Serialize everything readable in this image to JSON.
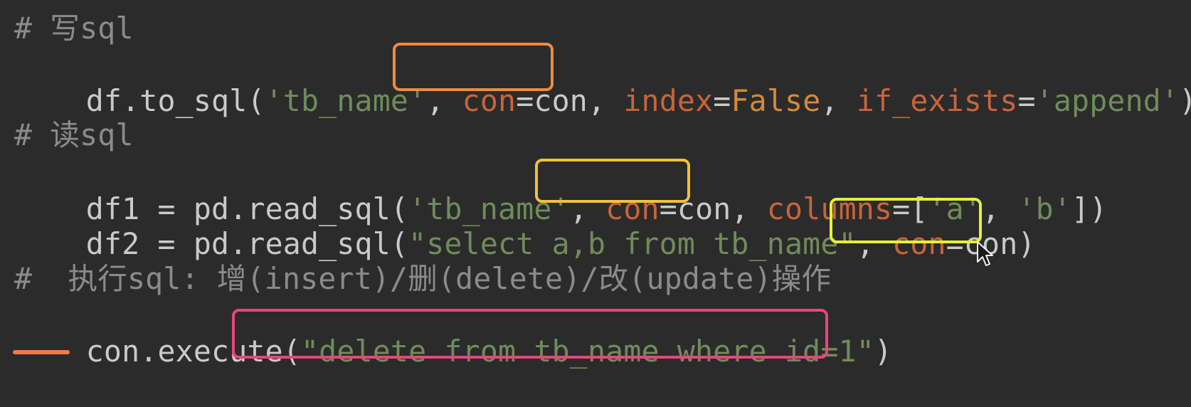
{
  "code": {
    "l1": {
      "comment": "# 写sql"
    },
    "l2": {
      "p1": "df.to_sql(",
      "s1": "'tb_name'",
      "p2": ", ",
      "k1": "con",
      "p3": "=con, ",
      "k2": "index",
      "p4": "=",
      "b1": "False",
      "p5": ", ",
      "k3": "if_exists",
      "p6": "=",
      "s2": "'append'",
      "p7": ")"
    },
    "l4": {
      "comment": "# 读sql"
    },
    "l5": {
      "p1": "df1 = pd.read_sql(",
      "s1": "'tb_name'",
      "p2": ", ",
      "k1": "con",
      "p3": "=con, ",
      "k2": "columns",
      "p4": "=[",
      "s2": "'a'",
      "p5": ", ",
      "s3": "'b'",
      "p6": "])"
    },
    "l6": {
      "p1": "df2 = pd.read_sql(",
      "s1": "\"select a,b from tb_name\"",
      "p2": ", ",
      "k1": "con",
      "p3": "=con)"
    },
    "l8": {
      "comment": "#  执行sql: 增(insert)/删(delete)/改(update)操作"
    },
    "l9": {
      "p1": "con",
      "p2": ".execute(",
      "s1": "\"delete from tb_name where id=1\"",
      "p3": ")"
    }
  },
  "highlight_colors": {
    "box1": "#f08a3c",
    "box2": "#f0c23a",
    "box3": "#e6ef3a",
    "box4": "#e9457a",
    "underline": "#f07a4a"
  },
  "icons": {
    "cursor": "mouse-pointer-icon"
  }
}
